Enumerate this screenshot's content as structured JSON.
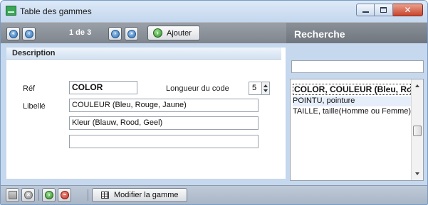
{
  "window": {
    "title": "Table des gammes",
    "icons": [
      "app-icon",
      "minimize-icon",
      "maximize-icon",
      "close-icon"
    ]
  },
  "toolbar": {
    "record_counter": "1 de 3",
    "add_label": "Ajouter",
    "nav_icons": [
      "first-record-icon",
      "previous-record-icon",
      "next-record-icon",
      "last-record-icon"
    ]
  },
  "search": {
    "title": "Recherche",
    "input_value": "",
    "results": [
      "COLOR, COULEUR (Bleu, Rouge, Jaune)",
      "POINTU, pointure",
      "TAILLE, taille(Homme ou Femme)"
    ],
    "selected_index": 0
  },
  "description": {
    "section_title": "Description",
    "ref_label": "Réf",
    "ref_value": "COLOR",
    "code_length_label": "Longueur du code",
    "code_length_value": "5",
    "libelle_label": "Libellé",
    "libelle_values": [
      "COULEUR (Bleu, Rouge, Jaune)",
      "Kleur (Blauw, Rood, Geel)",
      ""
    ]
  },
  "bottom_toolbar": {
    "modify_label": "Modifier la gamme",
    "icons": [
      "save-icon",
      "cancel-icon",
      "add-icon",
      "delete-icon",
      "grid-icon"
    ]
  },
  "colors": {
    "window_bg": "#c6d8ee",
    "toolbar_bg": "#8a9098",
    "selected_row_bg": "#e6eefa"
  }
}
